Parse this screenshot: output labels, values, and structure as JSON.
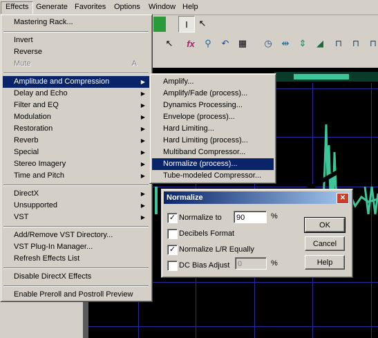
{
  "menubar": {
    "items": [
      "Effects",
      "Generate",
      "Favorites",
      "Options",
      "Window",
      "Help"
    ]
  },
  "effects_menu": {
    "items": [
      {
        "label": "Mastering Rack..."
      },
      {
        "label": "Invert"
      },
      {
        "label": "Reverse"
      },
      {
        "label": "Mute",
        "accel": "A"
      },
      {
        "label": "Amplitude and Compression"
      },
      {
        "label": "Delay and Echo"
      },
      {
        "label": "Filter and EQ"
      },
      {
        "label": "Modulation"
      },
      {
        "label": "Restoration"
      },
      {
        "label": "Reverb"
      },
      {
        "label": "Special"
      },
      {
        "label": "Stereo Imagery"
      },
      {
        "label": "Time and Pitch"
      },
      {
        "label": "DirectX"
      },
      {
        "label": "Unsupported"
      },
      {
        "label": "VST"
      },
      {
        "label": "Add/Remove VST Directory..."
      },
      {
        "label": "VST Plug-In Manager..."
      },
      {
        "label": "Refresh Effects List"
      },
      {
        "label": "Disable DirectX Effects"
      },
      {
        "label": "Enable Preroll and Postroll Preview"
      }
    ]
  },
  "amplitude_submenu": {
    "items": [
      "Amplify...",
      "Amplify/Fade (process)...",
      "Dynamics Processing...",
      "Envelope (process)...",
      "Hard Limiting...",
      "Hard Limiting (process)...",
      "Multiband Compressor...",
      "Normalize (process)...",
      "Tube-modeled Compressor..."
    ]
  },
  "dialog": {
    "title": "Normalize",
    "close": "✕",
    "normalize_to_label": "Normalize to",
    "normalize_to_value": "90",
    "decibels_label": "Decibels Format",
    "lr_label": "Normalize L/R Equally",
    "dc_label": "DC Bias Adjust",
    "dc_value": "0",
    "percent": "%",
    "ok": "OK",
    "cancel": "Cancel",
    "help": "Help",
    "check_mark": "✓"
  },
  "toolbar": {
    "icons": [
      "cursor-icon",
      "fx-icon",
      "pin-icon",
      "undo-icon",
      "grid-icon",
      "clock-icon",
      "split-icon",
      "arrows-icon",
      "ramp-icon",
      "filter-icon",
      "filter2-icon",
      "filter3-icon"
    ]
  },
  "colors": {
    "menu_highlight": "#0a246a",
    "waveform": "#3cc69a",
    "background": "#000000"
  }
}
